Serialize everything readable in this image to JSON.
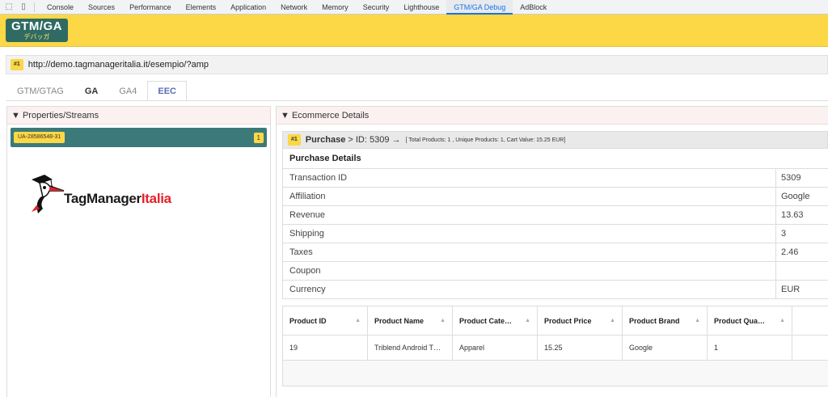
{
  "devtools": {
    "tabs": [
      "Console",
      "Sources",
      "Performance",
      "Elements",
      "Application",
      "Network",
      "Memory",
      "Security",
      "Lighthouse",
      "GTM/GA Debug",
      "AdBlock"
    ],
    "active_tab": "GTM/GA Debug"
  },
  "header": {
    "logo_main": "GTM/GA",
    "logo_sub": "デバッガ"
  },
  "url": {
    "badge": "#1",
    "text": "http://demo.tagmanageritalia.it/esempio/?amp"
  },
  "tabs": [
    {
      "label": "GTM/GTAG"
    },
    {
      "label": "GA"
    },
    {
      "label": "GA4"
    },
    {
      "label": "EEC"
    }
  ],
  "left": {
    "title": "Properties/Streams",
    "property_id": "UA-28586548-31",
    "property_count": "1",
    "brand_a": "TagManager",
    "brand_b": "Italia"
  },
  "right": {
    "title": "Ecommerce Details",
    "badge": "#1",
    "purchase_label": "Purchase",
    "purchase_id": "> ID: 5309 →",
    "purchase_summary": "[ Total Products: 1 , Unique Products: 1, Cart Value: 15.25 EUR]",
    "details_title": "Purchase Details",
    "details": [
      {
        "key": "Transaction ID",
        "value": "5309"
      },
      {
        "key": "Affiliation",
        "value": "Google"
      },
      {
        "key": "Revenue",
        "value": "13.63"
      },
      {
        "key": "Shipping",
        "value": "3"
      },
      {
        "key": "Taxes",
        "value": "2.46"
      },
      {
        "key": "Coupon",
        "value": ""
      },
      {
        "key": "Currency",
        "value": "EUR"
      }
    ],
    "grid_headers": [
      "Product ID",
      "Product Name",
      "Product Cate…",
      "Product Price",
      "Product Brand",
      "Product Qua…"
    ],
    "grid_row": [
      "19",
      "Triblend Android T…",
      "Apparel",
      "15.25",
      "Google",
      "1"
    ]
  },
  "colors": {
    "accent": "#fcd746",
    "teal": "#3c7a7a",
    "tab_active": "#5b6bb5"
  }
}
